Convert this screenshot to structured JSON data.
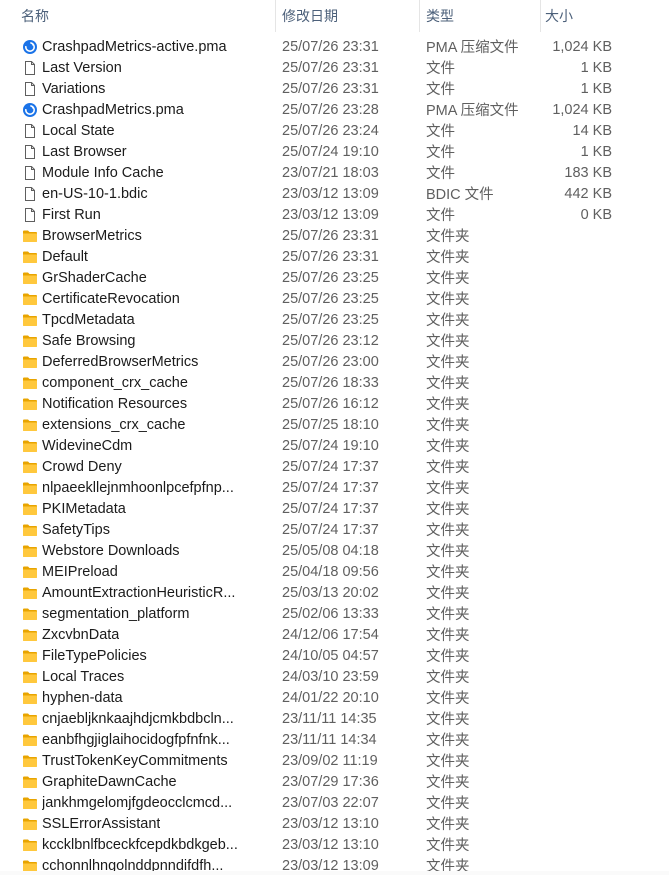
{
  "columns": {
    "name": "名称",
    "date": "修改日期",
    "type": "类型",
    "size": "大小"
  },
  "files": [
    {
      "name": "CrashpadMetrics-active.pma",
      "date": "25/07/26 23:31",
      "type": "PMA 压缩文件",
      "size": "1,024 KB",
      "icon": "pma-file-icon"
    },
    {
      "name": "Last Version",
      "date": "25/07/26 23:31",
      "type": "文件",
      "size": "1 KB",
      "icon": "file-icon"
    },
    {
      "name": "Variations",
      "date": "25/07/26 23:31",
      "type": "文件",
      "size": "1 KB",
      "icon": "file-icon"
    },
    {
      "name": "CrashpadMetrics.pma",
      "date": "25/07/26 23:28",
      "type": "PMA 压缩文件",
      "size": "1,024 KB",
      "icon": "pma-file-icon"
    },
    {
      "name": "Local State",
      "date": "25/07/26 23:24",
      "type": "文件",
      "size": "14 KB",
      "icon": "file-icon"
    },
    {
      "name": "Last Browser",
      "date": "25/07/24 19:10",
      "type": "文件",
      "size": "1 KB",
      "icon": "file-icon"
    },
    {
      "name": "Module Info Cache",
      "date": "23/07/21 18:03",
      "type": "文件",
      "size": "183 KB",
      "icon": "file-icon"
    },
    {
      "name": "en-US-10-1.bdic",
      "date": "23/03/12 13:09",
      "type": "BDIC 文件",
      "size": "442 KB",
      "icon": "file-icon"
    },
    {
      "name": "First Run",
      "date": "23/03/12 13:09",
      "type": "文件",
      "size": "0 KB",
      "icon": "file-icon"
    },
    {
      "name": "BrowserMetrics",
      "date": "25/07/26 23:31",
      "type": "文件夹",
      "size": "",
      "icon": "folder-icon"
    },
    {
      "name": "Default",
      "date": "25/07/26 23:31",
      "type": "文件夹",
      "size": "",
      "icon": "folder-icon"
    },
    {
      "name": "GrShaderCache",
      "date": "25/07/26 23:25",
      "type": "文件夹",
      "size": "",
      "icon": "folder-icon"
    },
    {
      "name": "CertificateRevocation",
      "date": "25/07/26 23:25",
      "type": "文件夹",
      "size": "",
      "icon": "folder-icon"
    },
    {
      "name": "TpcdMetadata",
      "date": "25/07/26 23:25",
      "type": "文件夹",
      "size": "",
      "icon": "folder-icon"
    },
    {
      "name": "Safe Browsing",
      "date": "25/07/26 23:12",
      "type": "文件夹",
      "size": "",
      "icon": "folder-icon"
    },
    {
      "name": "DeferredBrowserMetrics",
      "date": "25/07/26 23:00",
      "type": "文件夹",
      "size": "",
      "icon": "folder-icon"
    },
    {
      "name": "component_crx_cache",
      "date": "25/07/26 18:33",
      "type": "文件夹",
      "size": "",
      "icon": "folder-icon"
    },
    {
      "name": "Notification Resources",
      "date": "25/07/26 16:12",
      "type": "文件夹",
      "size": "",
      "icon": "folder-icon"
    },
    {
      "name": "extensions_crx_cache",
      "date": "25/07/25 18:10",
      "type": "文件夹",
      "size": "",
      "icon": "folder-icon"
    },
    {
      "name": "WidevineCdm",
      "date": "25/07/24 19:10",
      "type": "文件夹",
      "size": "",
      "icon": "folder-icon"
    },
    {
      "name": "Crowd Deny",
      "date": "25/07/24 17:37",
      "type": "文件夹",
      "size": "",
      "icon": "folder-icon"
    },
    {
      "name": "nlpaeekllejnmhoonlpcefpfnp...",
      "date": "25/07/24 17:37",
      "type": "文件夹",
      "size": "",
      "icon": "folder-icon"
    },
    {
      "name": "PKIMetadata",
      "date": "25/07/24 17:37",
      "type": "文件夹",
      "size": "",
      "icon": "folder-icon"
    },
    {
      "name": "SafetyTips",
      "date": "25/07/24 17:37",
      "type": "文件夹",
      "size": "",
      "icon": "folder-icon"
    },
    {
      "name": "Webstore Downloads",
      "date": "25/05/08 04:18",
      "type": "文件夹",
      "size": "",
      "icon": "folder-icon"
    },
    {
      "name": "MEIPreload",
      "date": "25/04/18 09:56",
      "type": "文件夹",
      "size": "",
      "icon": "folder-icon"
    },
    {
      "name": "AmountExtractionHeuristicR...",
      "date": "25/03/13 20:02",
      "type": "文件夹",
      "size": "",
      "icon": "folder-icon"
    },
    {
      "name": "segmentation_platform",
      "date": "25/02/06 13:33",
      "type": "文件夹",
      "size": "",
      "icon": "folder-icon"
    },
    {
      "name": "ZxcvbnData",
      "date": "24/12/06 17:54",
      "type": "文件夹",
      "size": "",
      "icon": "folder-icon"
    },
    {
      "name": "FileTypePolicies",
      "date": "24/10/05 04:57",
      "type": "文件夹",
      "size": "",
      "icon": "folder-icon"
    },
    {
      "name": "Local Traces",
      "date": "24/03/10 23:59",
      "type": "文件夹",
      "size": "",
      "icon": "folder-icon"
    },
    {
      "name": "hyphen-data",
      "date": "24/01/22 20:10",
      "type": "文件夹",
      "size": "",
      "icon": "folder-icon"
    },
    {
      "name": "cnjaebljknkaajhdjcmkbdbcln...",
      "date": "23/11/11 14:35",
      "type": "文件夹",
      "size": "",
      "icon": "folder-icon"
    },
    {
      "name": "eanbfhgjiglaihocidogfpfnfnk...",
      "date": "23/11/11 14:34",
      "type": "文件夹",
      "size": "",
      "icon": "folder-icon"
    },
    {
      "name": "TrustTokenKeyCommitments",
      "date": "23/09/02 11:19",
      "type": "文件夹",
      "size": "",
      "icon": "folder-icon"
    },
    {
      "name": "GraphiteDawnCache",
      "date": "23/07/29 17:36",
      "type": "文件夹",
      "size": "",
      "icon": "folder-icon"
    },
    {
      "name": "jankhmgelomjfgdeocclcmcd...",
      "date": "23/07/03 22:07",
      "type": "文件夹",
      "size": "",
      "icon": "folder-icon"
    },
    {
      "name": "SSLErrorAssistant",
      "date": "23/03/12 13:10",
      "type": "文件夹",
      "size": "",
      "icon": "folder-icon"
    },
    {
      "name": "kccklbnlfbceckfcepdkbdkgeb...",
      "date": "23/03/12 13:10",
      "type": "文件夹",
      "size": "",
      "icon": "folder-icon"
    },
    {
      "name": "cchonnlhngolnddpnndifdfh...",
      "date": "23/03/12 13:09",
      "type": "文件夹",
      "size": "",
      "icon": "folder-icon"
    }
  ]
}
